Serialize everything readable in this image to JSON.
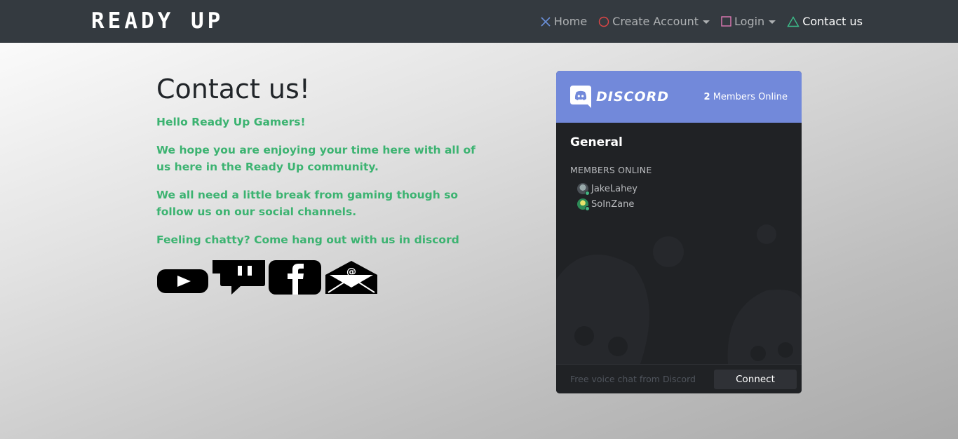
{
  "brand": "READY UP",
  "nav": {
    "home": "Home",
    "create_account": "Create Account",
    "login": "Login",
    "contact": "Contact us"
  },
  "main": {
    "title": "Contact us!",
    "paragraphs": [
      "Hello Ready Up Gamers!",
      "We hope you are enjoying your time here with all of us here in the Ready Up community.",
      "We all need a little break from gaming though so follow us on our social channels.",
      "Feeling chatty? Come hang out with us in discord"
    ],
    "socials": [
      "youtube-icon",
      "twitch-icon",
      "facebook-icon",
      "email-icon"
    ]
  },
  "discord": {
    "logo": "DISCORD",
    "members_count": "2",
    "members_online_label": "Members Online",
    "channel": "General",
    "members_header": "MEMBERS ONLINE",
    "members": [
      "JakeLahey",
      "SoInZane"
    ],
    "footer_text": "Free voice chat from Discord",
    "connect_label": "Connect",
    "accent_color": "#7289da"
  }
}
